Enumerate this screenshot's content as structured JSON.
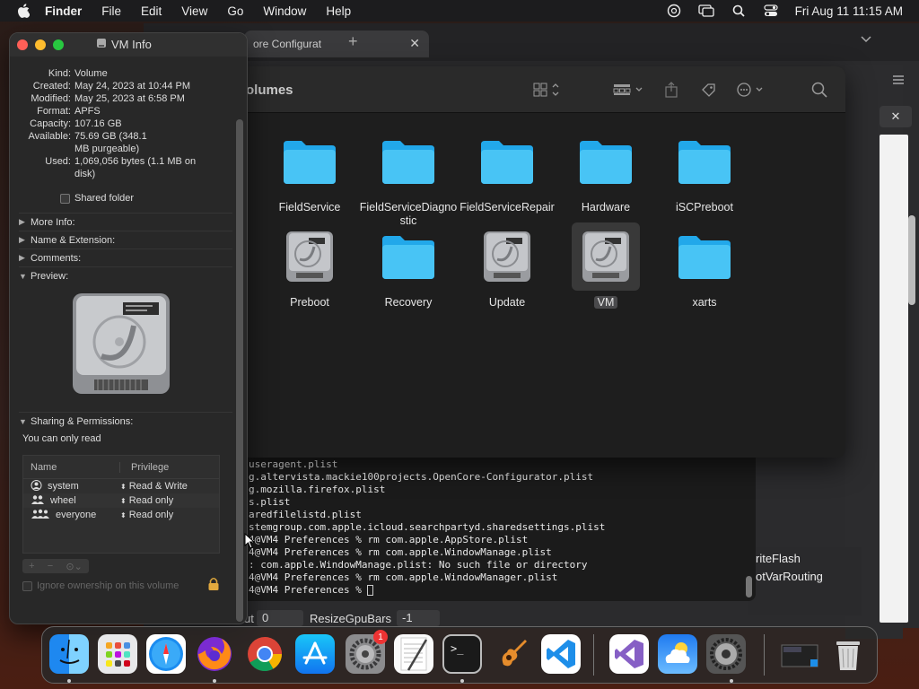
{
  "menubar": {
    "app_name": "Finder",
    "items": [
      "File",
      "Edit",
      "View",
      "Go",
      "Window",
      "Help"
    ],
    "clock": "Fri Aug 11  11:15 AM"
  },
  "browser": {
    "tab_title": "ore Configurat",
    "tab_close": "✕",
    "new_tab": "+",
    "panel_close": "✕"
  },
  "finder": {
    "title": "olumes",
    "items": [
      {
        "label": "FieldService",
        "kind": "folder"
      },
      {
        "label": "FieldServiceDiagnostic",
        "kind": "folder"
      },
      {
        "label": "FieldServiceRepair",
        "kind": "folder"
      },
      {
        "label": "Hardware",
        "kind": "folder"
      },
      {
        "label": "iSCPreboot",
        "kind": "folder"
      },
      {
        "label": "Preboot",
        "kind": "drive"
      },
      {
        "label": "Recovery",
        "kind": "folder"
      },
      {
        "label": "Update",
        "kind": "drive"
      },
      {
        "label": "VM",
        "kind": "drive",
        "selected": true
      },
      {
        "label": "xarts",
        "kind": "folder"
      }
    ]
  },
  "info": {
    "title": "VM Info",
    "fields": [
      {
        "k": "Kind:",
        "v": "Volume"
      },
      {
        "k": "Created:",
        "v": "May 24, 2023 at 10:44 PM"
      },
      {
        "k": "Modified:",
        "v": "May 25, 2023 at 6:58 PM"
      },
      {
        "k": "Format:",
        "v": "APFS"
      },
      {
        "k": "Capacity:",
        "v": "107.16 GB"
      },
      {
        "k": "Available:",
        "v": "75.69 GB (348.1 MB purgeable)"
      },
      {
        "k": "Used:",
        "v": "1,069,056 bytes (1.1 MB on disk)"
      }
    ],
    "shared_folder": "Shared folder",
    "sections": [
      "More Info:",
      "Name & Extension:",
      "Comments:",
      "Preview:",
      "Sharing & Permissions:"
    ],
    "read_note": "You can only read",
    "perm_headers": [
      "Name",
      "Privilege"
    ],
    "perms": [
      {
        "name": "system",
        "priv": "Read & Write"
      },
      {
        "name": "wheel",
        "priv": "Read only"
      },
      {
        "name": "everyone",
        "priv": "Read only"
      }
    ],
    "ignore_ownership": "Ignore ownership on this volume"
  },
  "terminal": {
    "lines": [
      "useragent.plist",
      "g.altervista.mackie100projects.OpenCore-Configurator.plist",
      "g.mozilla.firefox.plist",
      "s.plist",
      "aredfilelistd.plist",
      "stemgroup.com.apple.icloud.searchpartyd.sharedsettings.plist",
      "4@VM4 Preferences % rm com.apple.AppStore.plist",
      "4@VM4 Preferences % rm com.apple.WindowManage.plist",
      ": com.apple.WindowManage.plist: No such file or directory",
      "4@VM4 Preferences % rm com.apple.WindowManager.plist",
      "4@VM4 Preferences % "
    ]
  },
  "configurator": {
    "right_items": [
      "riteFlash",
      "otVarRouting"
    ],
    "bottom_left_label": "ut",
    "bottom_left_value": "0",
    "resize_label": "ResizeGpuBars",
    "resize_value": "-1"
  },
  "dock": {
    "apps": [
      "Finder",
      "Launchpad",
      "Safari",
      "Firefox",
      "Chrome",
      "App Store",
      "System Preferences",
      "TextEdit",
      "Terminal",
      "GarageBand",
      "Visual Studio Code",
      "Visual Studio",
      "iCloud",
      "System Settings",
      "Screenshot",
      "Trash"
    ],
    "badge": "1"
  }
}
